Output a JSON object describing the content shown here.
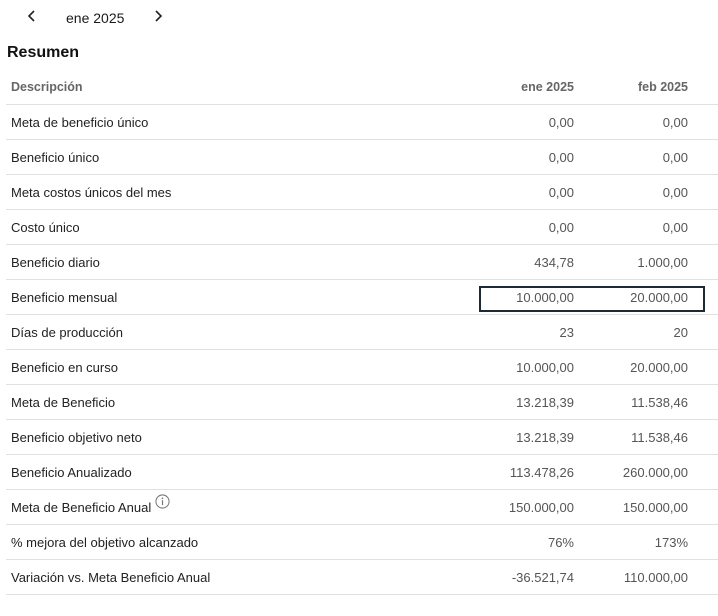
{
  "nav": {
    "period": "ene 2025",
    "prev_icon": "chevron-left-icon",
    "next_icon": "chevron-right-icon"
  },
  "title": "Resumen",
  "table": {
    "headers": {
      "description": "Descripción",
      "jan": "ene 2025",
      "feb": "feb 2025"
    },
    "rows": [
      {
        "label": "Meta de beneficio único",
        "jan": "0,00",
        "feb": "0,00"
      },
      {
        "label": "Beneficio único",
        "jan": "0,00",
        "feb": "0,00"
      },
      {
        "label": "Meta costos únicos del mes",
        "jan": "0,00",
        "feb": "0,00"
      },
      {
        "label": "Costo único",
        "jan": "0,00",
        "feb": "0,00"
      },
      {
        "label": "Beneficio diario",
        "jan": "434,78",
        "feb": "1.000,00"
      },
      {
        "label": "Beneficio mensual",
        "jan": "10.000,00",
        "feb": "20.000,00",
        "highlighted": true
      },
      {
        "label": "Días de producción",
        "jan": "23",
        "feb": "20"
      },
      {
        "label": "Beneficio en curso",
        "jan": "10.000,00",
        "feb": "20.000,00"
      },
      {
        "label": "Meta de Beneficio",
        "jan": "13.218,39",
        "feb": "11.538,46"
      },
      {
        "label": "Beneficio objetivo neto",
        "jan": "13.218,39",
        "feb": "11.538,46"
      },
      {
        "label": "Beneficio Anualizado",
        "jan": "113.478,26",
        "feb": "260.000,00"
      },
      {
        "label": "Meta de Beneficio Anual",
        "jan": "150.000,00",
        "feb": "150.000,00",
        "info_icon": "info-icon"
      },
      {
        "label": "% mejora del objetivo alcanzado",
        "jan": "76%",
        "feb": "173%"
      },
      {
        "label": "Variación vs. Meta Beneficio Anual",
        "jan": "-36.521,74",
        "feb": "110.000,00"
      }
    ]
  },
  "colors": {
    "highlight_border": "#1c2b33",
    "row_divider": "#e0e0e0"
  }
}
